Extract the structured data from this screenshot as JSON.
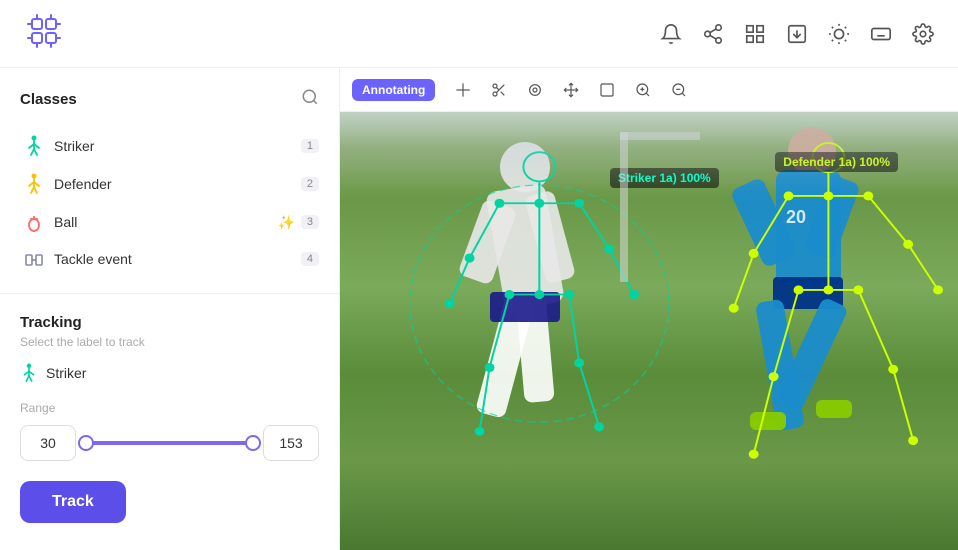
{
  "header": {
    "logo_alt": "Logo",
    "icons": [
      "bell",
      "share",
      "grid",
      "download",
      "brightness",
      "keyboard",
      "settings"
    ]
  },
  "sidebar": {
    "classes_title": "Classes",
    "classes": [
      {
        "id": 1,
        "label": "Striker",
        "badge": "1",
        "icon": "striker",
        "color": "#00d4a0"
      },
      {
        "id": 2,
        "label": "Defender",
        "badge": "2",
        "icon": "defender",
        "color": "#f5c400"
      },
      {
        "id": 3,
        "label": "Ball",
        "badge": "3",
        "icon": "ball",
        "color": "#ff6b6b",
        "extra": true
      },
      {
        "id": 4,
        "label": "Tackle event",
        "badge": "4",
        "icon": "tackle",
        "color": "#8888aa"
      }
    ]
  },
  "tracking": {
    "title": "Tracking",
    "subtitle": "Select the label to track",
    "selected_label": "Striker",
    "range_label": "Range",
    "range_min": "30",
    "range_max": "153",
    "track_button": "Track"
  },
  "toolbar": {
    "annotating_label": "Annotating",
    "tools": [
      "+",
      "✂",
      "⊙",
      "✕",
      "□",
      "⊕",
      "⊖"
    ]
  },
  "annotations": {
    "striker_label": "Striker 1a)  100%",
    "defender_label": "Defender 1a)  100%"
  }
}
